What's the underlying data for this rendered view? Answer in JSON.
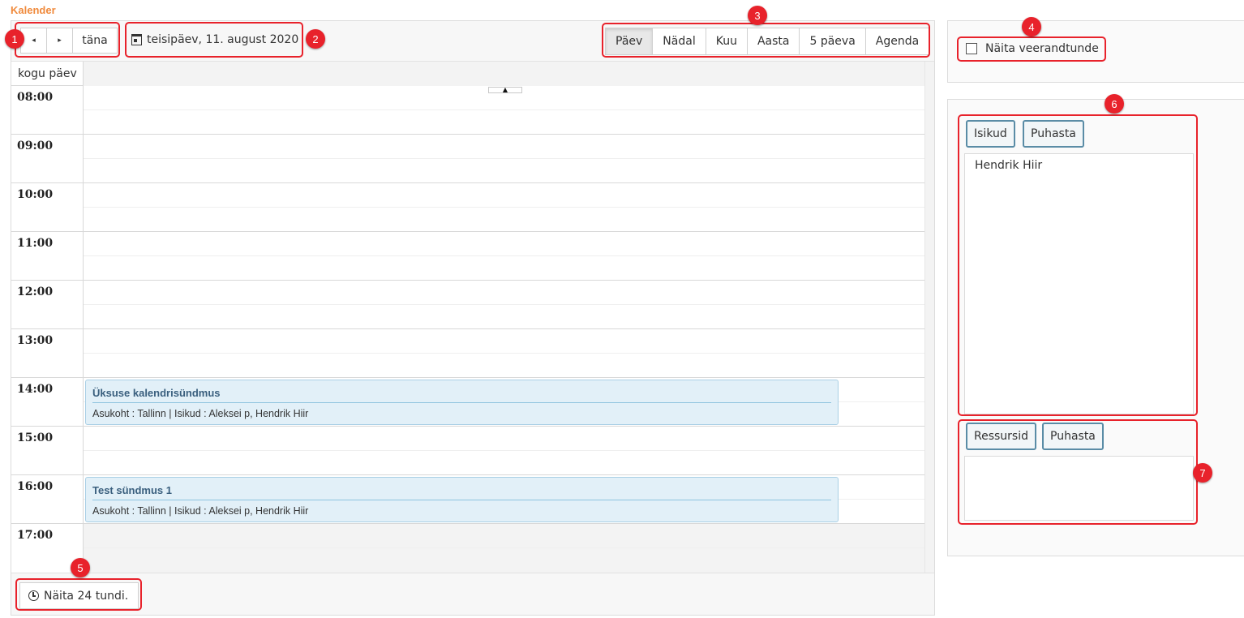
{
  "app": {
    "title": "Kalender"
  },
  "nav": {
    "prev_icon": "◂",
    "next_icon": "▸",
    "today_label": "täna"
  },
  "date_picker": {
    "label": "teisipäev, 11. august 2020"
  },
  "views": [
    "Päev",
    "Nädal",
    "Kuu",
    "Aasta",
    "5 päeva",
    "Agenda"
  ],
  "active_view": "Päev",
  "grid": {
    "allday_label": "kogu päev",
    "scroll_up_icon": "▲",
    "hours": [
      "08:00",
      "09:00",
      "10:00",
      "11:00",
      "12:00",
      "13:00",
      "14:00",
      "15:00",
      "16:00",
      "17:00"
    ]
  },
  "events": [
    {
      "title": "Üksuse kalendrisündmus",
      "details": "Asukoht : Tallinn | Isikud : Aleksei p, Hendrik Hiir",
      "start": "14:00"
    },
    {
      "title": "Test sündmus 1",
      "details": "Asukoht : Tallinn | Isikud : Aleksei p, Hendrik Hiir",
      "start": "16:00"
    }
  ],
  "footer": {
    "show24_label": "Näita 24 tundi."
  },
  "side": {
    "quarter_hours_label": "Näita veerandtunde",
    "persons_button": "Isikud",
    "persons_clear": "Puhasta",
    "persons_list": [
      "Hendrik Hiir"
    ],
    "resources_button": "Ressursid",
    "resources_clear": "Puhasta"
  },
  "annotations": [
    "1",
    "2",
    "3",
    "4",
    "5",
    "6",
    "7"
  ],
  "colors": {
    "accent_orange": "#f08a3c",
    "annotation_red": "#e8222b",
    "event_bg": "#e2f0f8",
    "event_title": "#3a5f7e"
  }
}
